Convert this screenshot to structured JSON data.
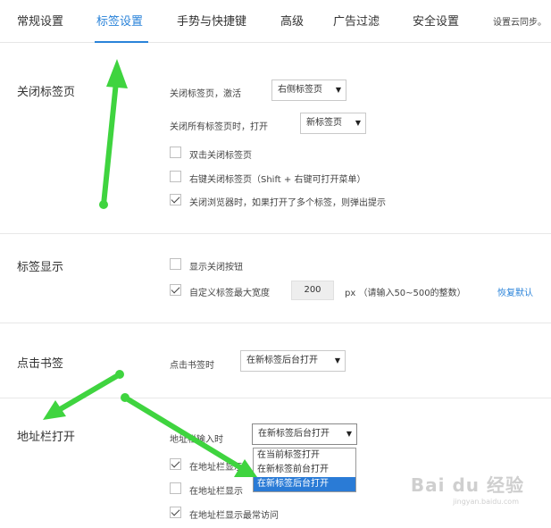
{
  "tabs": [
    {
      "label": "常规设置"
    },
    {
      "label": "标签设置"
    },
    {
      "label": "手势与快捷键"
    },
    {
      "label": "高级"
    },
    {
      "label": "广告过滤"
    },
    {
      "label": "安全设置"
    },
    {
      "label": "设置云同步。"
    }
  ],
  "close_tab": {
    "title": "关闭标签页",
    "after_close_label": "关闭标签页，激活",
    "after_close_value": "右侧标签页",
    "after_close_all_label": "关闭所有标签页时，打开",
    "after_close_all_value": "新标签页",
    "opt_double_click": "双击关闭标签页",
    "opt_right_click": "右键关闭标签页（Shift + 右键可打开菜单）",
    "opt_warn_multi": "关闭浏览器时，如果打开了多个标签，则弹出提示"
  },
  "tab_display": {
    "title": "标签显示",
    "opt_show_close": "显示关闭按钮",
    "opt_custom_width": "自定义标签最大宽度",
    "width_value": "200",
    "unit_hint": "px （请输入50~500的整数）",
    "restore_default": "恢复默认"
  },
  "bookmark_click": {
    "title": "点击书签",
    "label": "点击书签时",
    "value": "在新标签后台打开"
  },
  "address_bar": {
    "title": "地址栏打开",
    "label": "地址栏输入时",
    "value": "在新标签后台打开",
    "options": [
      "在当前标签打开",
      "在新标签前台打开",
      "在新标签后台打开"
    ],
    "opt_1": "在地址栏显示",
    "opt_2": "在地址栏显示",
    "opt_3": "在地址栏显示最常访问"
  },
  "watermark": {
    "brand": "Bai du 经验",
    "url": "jingyan.baidu.com"
  },
  "colors": {
    "accent": "#2a83d9",
    "arrow": "#3fd43f"
  }
}
